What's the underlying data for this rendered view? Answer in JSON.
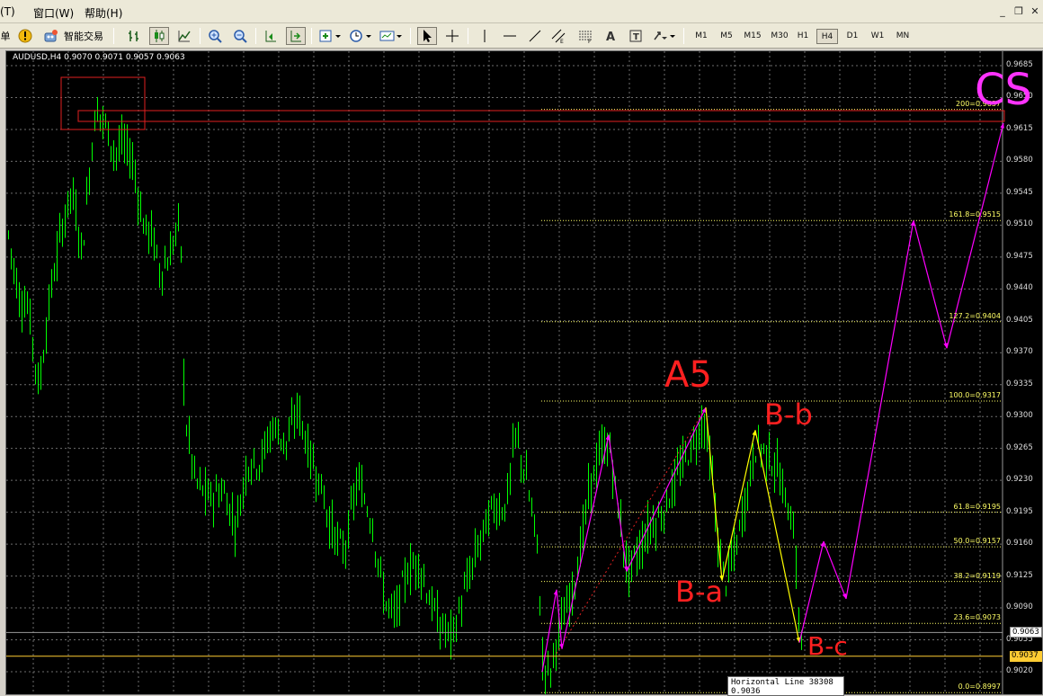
{
  "menu": {
    "items": [
      "(T)",
      "窗口(W)",
      "帮助(H)"
    ]
  },
  "window_controls": [
    "_",
    "❐",
    "✕"
  ],
  "toolbar": {
    "left_glyph": "单",
    "expert_label": "智能交易",
    "icons": [
      "bar-chart-icon",
      "candlestick-icon",
      "line-chart-icon",
      "zoom-in-icon",
      "zoom-out-icon",
      "chart-shift-icon",
      "autoscroll-icon",
      "grid-icon",
      "indicators-icon",
      "periods-icon",
      "templates-icon",
      "cursor-icon",
      "crosshair-icon",
      "vertical-line-icon",
      "horizontal-line-icon",
      "trendline-icon",
      "equidistant-channel-icon",
      "fibonacci-icon",
      "text-icon",
      "text-label-icon",
      "arrows-icon"
    ],
    "timeframes": [
      "M1",
      "M5",
      "M15",
      "M30",
      "H1",
      "H4",
      "D1",
      "W1",
      "MN"
    ],
    "active_timeframe": "H4"
  },
  "chart_info": "AUDUSD,H4  0.9070 0.9071 0.9057 0.9063",
  "price_axis": [
    "0.9685",
    "0.9650",
    "0.9615",
    "0.9580",
    "0.9545",
    "0.9510",
    "0.9475",
    "0.9440",
    "0.9405",
    "0.9370",
    "0.9335",
    "0.9300",
    "0.9265",
    "0.9230",
    "0.9195",
    "0.9160",
    "0.9125",
    "0.9090",
    "0.9055",
    "0.9020"
  ],
  "fib_levels": [
    {
      "label": "200=0.9637",
      "value": 0.9637
    },
    {
      "label": "161.8=0.9515",
      "value": 0.9515
    },
    {
      "label": "127.2=0.9404",
      "value": 0.9404
    },
    {
      "label": "100.0=0.9317",
      "value": 0.9317
    },
    {
      "label": "61.8=0.9195",
      "value": 0.9195
    },
    {
      "label": "50.0=0.9157",
      "value": 0.9157
    },
    {
      "label": "38.2=0.9119",
      "value": 0.9119
    },
    {
      "label": "23.6=0.9073",
      "value": 0.9073
    },
    {
      "label": "0.0=0.8997",
      "value": 0.8997
    }
  ],
  "current_price": "0.9063",
  "hline_price": "0.9037",
  "tooltip": {
    "line1": "Horizontal Line 38308",
    "line2": "0.9036"
  },
  "annotations": {
    "a5": "A5",
    "bb": "B-b",
    "ba": "B-a",
    "bc": "B-c",
    "cs": "CS"
  },
  "colors": {
    "bullish": "#00ff00",
    "bearish": "#00ff00",
    "grid": "#6e6e6e",
    "fib": "#ffff66",
    "wave": "#ff00ff",
    "wave_yellow": "#ffff00",
    "annotation": "#ff2020",
    "hline": "#ffcc33"
  }
}
